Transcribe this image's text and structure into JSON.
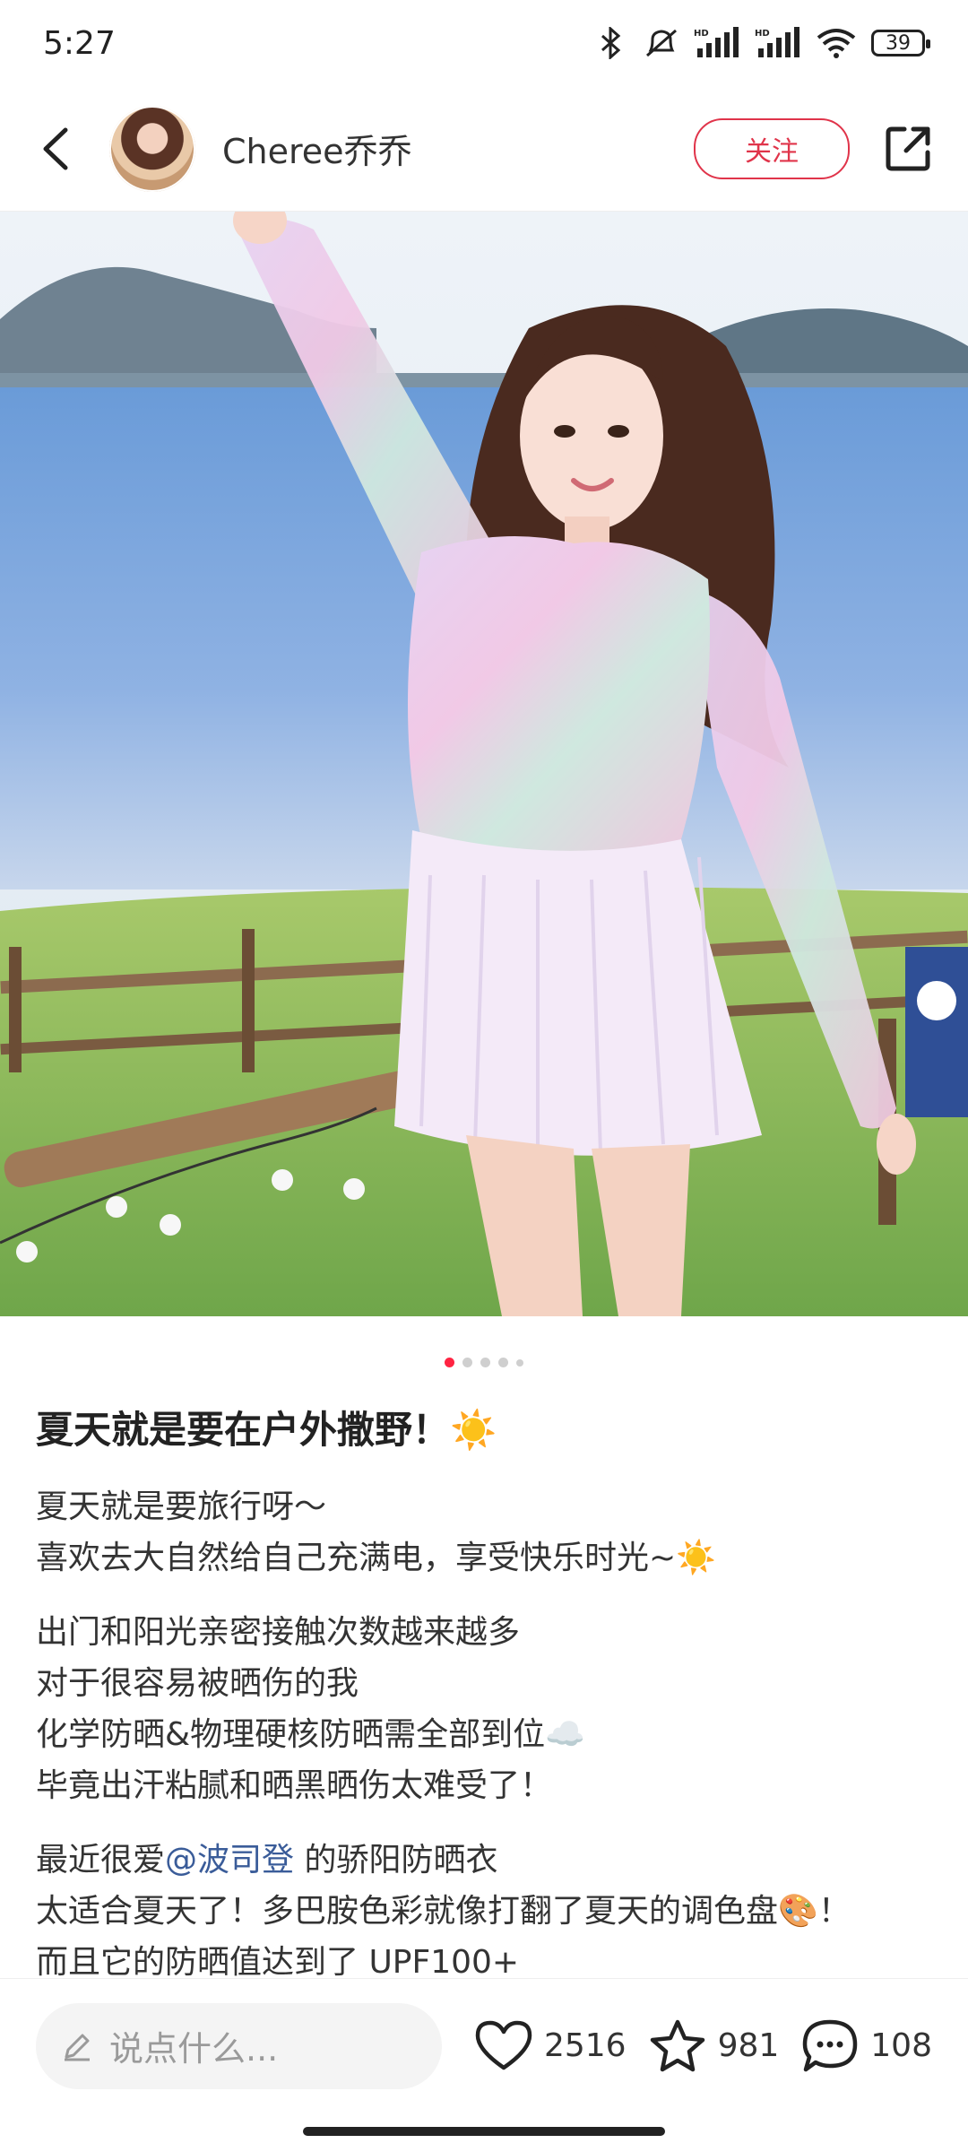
{
  "status_bar": {
    "time": "5:27",
    "battery": "39",
    "icons": [
      "bluetooth-icon",
      "mute-icon",
      "signal-hd-icon",
      "signal-hd-icon",
      "wifi-icon",
      "battery-icon"
    ]
  },
  "header": {
    "username": "Cheree乔乔",
    "follow_label": "关注",
    "icons": {
      "back": "back-arrow-icon",
      "share": "share-icon"
    }
  },
  "carousel": {
    "total": 5,
    "active": 0
  },
  "post": {
    "title": "夏天就是要在户外撒野！☀️",
    "paragraphs": [
      [
        "夏天就是要旅行呀～",
        "喜欢去大自然给自己充满电，享受快乐时光~☀️"
      ],
      [
        "出门和阳光亲密接触次数越来越多",
        "对于很容易被晒伤的我",
        "化学防晒&物理硬核防晒需全部到位☁️",
        "毕竟出汗粘腻和晒黑晒伤太难受了！"
      ]
    ],
    "last_paragraph": {
      "line1_prefix": "最近很爱",
      "mention": "@波司登",
      "line1_suffix": " 的骄阳防晒衣",
      "line2": "太适合夏天了！多巴胺色彩就像打翻了夏天的调色盘🎨！",
      "line3": "而且它的防晒值达到了 UPF100+"
    }
  },
  "bottom_bar": {
    "comment_placeholder": "说点什么...",
    "likes": "2516",
    "favorites": "981",
    "comments": "108"
  }
}
